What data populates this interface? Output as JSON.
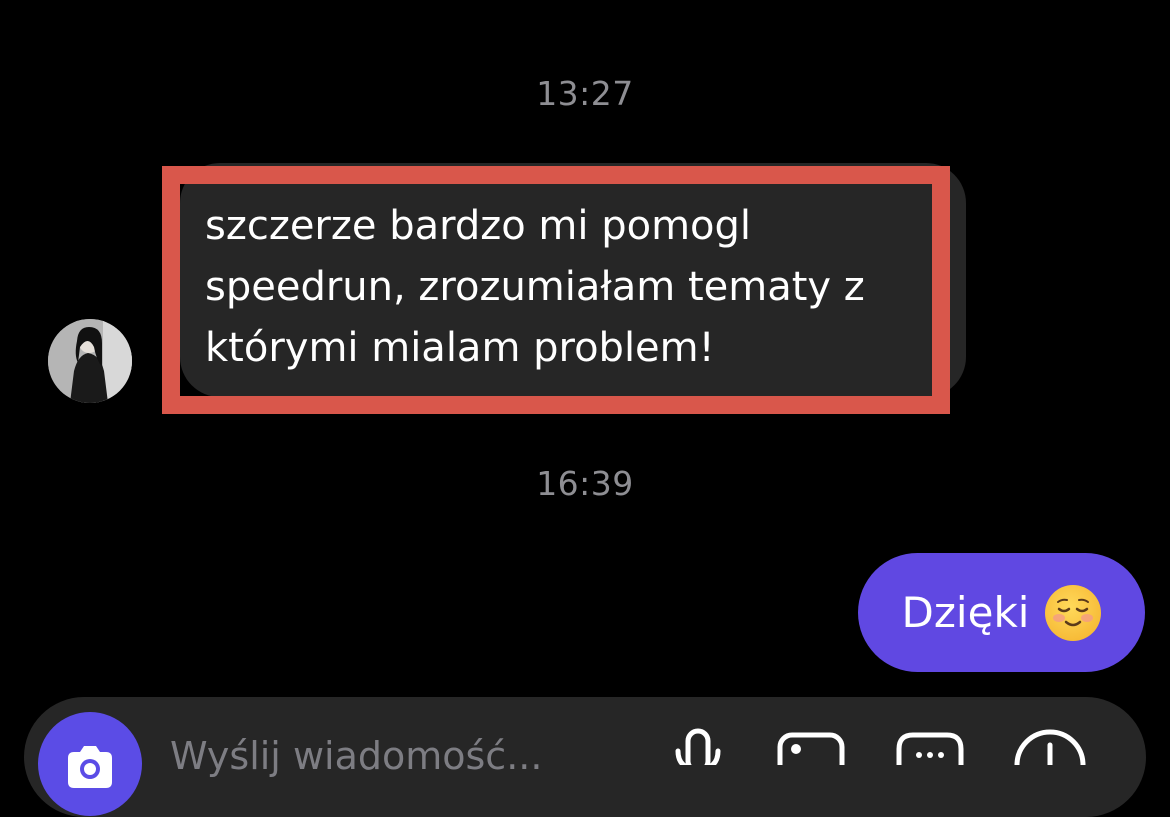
{
  "timestamps": {
    "first": "13:27",
    "second": "16:39"
  },
  "incoming_message": {
    "lines": [
      "szczerze bardzo mi pomogl",
      "speedrun, zrozumiałam tematy z",
      "którymi mialam problem!"
    ],
    "highlight_color": "#d9574b"
  },
  "outgoing_message": {
    "text": "Dzięki",
    "emoji": "smiling-face-icon"
  },
  "composer": {
    "placeholder": "Wyślij wiadomość...",
    "icons": [
      "camera-icon",
      "microphone-icon",
      "gallery-icon",
      "sticker-icon",
      "add-icon"
    ]
  },
  "colors": {
    "background": "#000000",
    "incoming_bubble": "#262626",
    "outgoing_bubble": "#6048e2",
    "accent": "#5b4ce6"
  }
}
